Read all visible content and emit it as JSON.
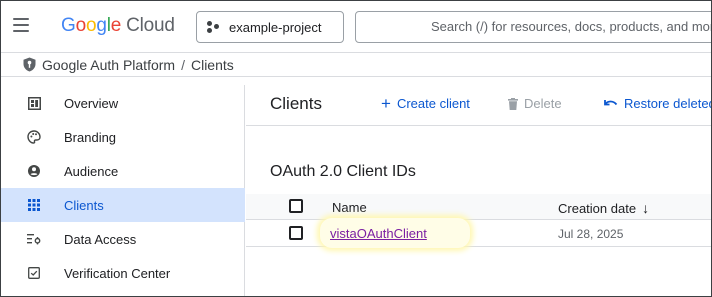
{
  "header": {
    "logo_google": "Google",
    "logo_cloud": "Cloud",
    "project_name": "example-project",
    "search_placeholder": "Search (/) for resources, docs, products, and more"
  },
  "breadcrumb": {
    "root": "Google Auth Platform",
    "separator": "/",
    "current": "Clients"
  },
  "sidebar": {
    "items": [
      {
        "label": "Overview",
        "icon": "dashboard-icon",
        "active": false
      },
      {
        "label": "Branding",
        "icon": "palette-icon",
        "active": false
      },
      {
        "label": "Audience",
        "icon": "person-circle-icon",
        "active": false
      },
      {
        "label": "Clients",
        "icon": "grid-icon",
        "active": true
      },
      {
        "label": "Data Access",
        "icon": "filter-settings-icon",
        "active": false
      },
      {
        "label": "Verification Center",
        "icon": "verified-checkbox-icon",
        "active": false
      }
    ]
  },
  "toolbar": {
    "title": "Clients",
    "create_label": "Create client",
    "delete_label": "Delete",
    "restore_label": "Restore deleted"
  },
  "section": {
    "title": "OAuth 2.0 Client IDs"
  },
  "table": {
    "columns": {
      "name": "Name",
      "creation_date": "Creation date",
      "sort_arrow": "↓"
    },
    "rows": [
      {
        "name": "vistaOAuthClient",
        "creation_date": "Jul 28, 2025"
      }
    ]
  },
  "colors": {
    "accent": "#0b57d0",
    "active_nav_bg": "#d3e3fd",
    "visited_link": "#7b1fa2",
    "highlight": "#fffde7"
  }
}
